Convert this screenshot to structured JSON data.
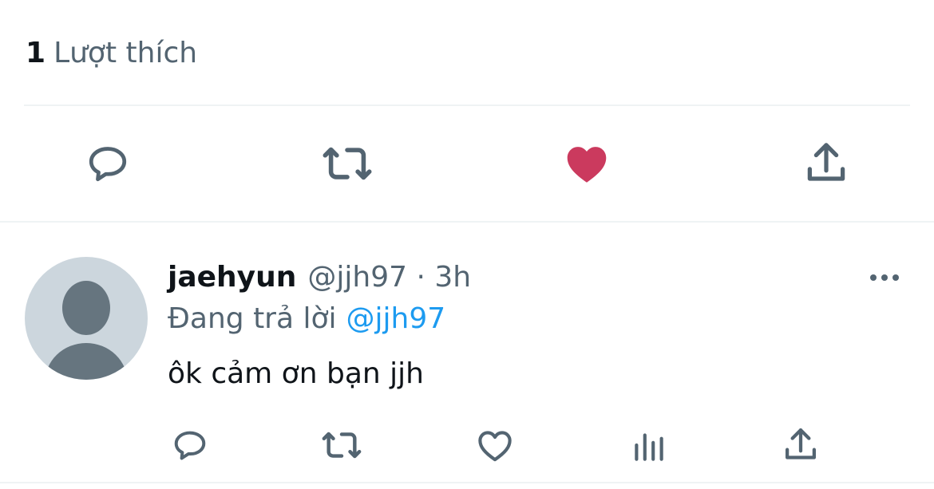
{
  "likes": {
    "count": "1",
    "label": "Lượt thích"
  },
  "tweet_actions": [
    {
      "name": "reply",
      "icon": "comment-icon"
    },
    {
      "name": "retweet",
      "icon": "retweet-icon"
    },
    {
      "name": "like",
      "icon": "heart-filled-icon",
      "active": true
    },
    {
      "name": "share",
      "icon": "share-icon"
    }
  ],
  "reply": {
    "display_name": "jaehyun",
    "handle": "@jjh97",
    "time": "3h",
    "meta": "@jjh97 · 3h",
    "replying_to_label": "Đang trả lời",
    "replying_to_handle": "@jjh97",
    "text": "ôk cảm ơn bạn jjh",
    "avatar": "default-avatar-icon",
    "more_icon": "more-horizontal-icon"
  },
  "reply_actions": [
    {
      "name": "reply",
      "icon": "comment-icon"
    },
    {
      "name": "retweet",
      "icon": "retweet-icon"
    },
    {
      "name": "like",
      "icon": "heart-outline-icon"
    },
    {
      "name": "analytics",
      "icon": "bar-chart-icon"
    },
    {
      "name": "share",
      "icon": "share-icon"
    }
  ],
  "colors": {
    "icon_gray": "#536471",
    "like_red": "#cb3a5e",
    "mention_blue": "#1d9bf0",
    "divider": "#eff3f4",
    "avatar_bg": "#ccd6dd",
    "avatar_fg": "#66757f"
  }
}
